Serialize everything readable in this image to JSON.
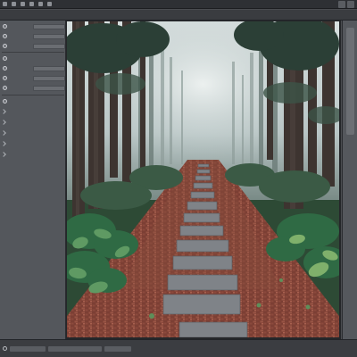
{
  "menubar": {
    "items": [
      {
        "label": "",
        "icon": "app-icon"
      },
      {
        "label": "",
        "icon": "file-icon"
      },
      {
        "label": "",
        "icon": "edit-icon"
      },
      {
        "label": "",
        "icon": "view-icon"
      },
      {
        "label": "",
        "icon": "tools-icon"
      },
      {
        "label": "",
        "icon": "window-icon"
      }
    ]
  },
  "left_panel": {
    "radio_rows": [
      {
        "label": "",
        "field": ""
      },
      {
        "label": "",
        "field": ""
      },
      {
        "label": "",
        "field": ""
      },
      {
        "label": "",
        "field": ""
      },
      {
        "label": "",
        "field": ""
      },
      {
        "label": "",
        "field": ""
      },
      {
        "label": "",
        "field": ""
      },
      {
        "label": "",
        "field": ""
      }
    ],
    "list_items": []
  },
  "canvas": {
    "image_subject": "forest-stone-path-photo"
  },
  "colors": {
    "chrome_dark": "#2e3034",
    "panel": "#54575c",
    "canvas_border": "#25272a",
    "fog": "#c9d3d4",
    "foliage": "#2f5a3a",
    "path_bricks": "#8a4a3c",
    "stones": "#7d8186"
  }
}
